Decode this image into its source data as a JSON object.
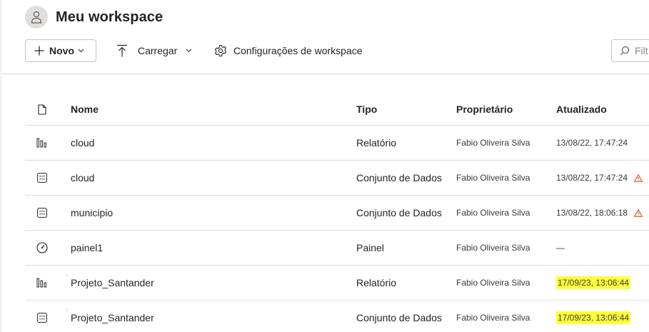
{
  "workspace": {
    "title": "Meu workspace",
    "avatar_icon": "person-icon"
  },
  "toolbar": {
    "new_label": "Novo",
    "upload_label": "Carregar",
    "settings_label": "Configurações de workspace",
    "filter_placeholder": "Filt"
  },
  "table": {
    "columns": {
      "name": "Nome",
      "type": "Tipo",
      "owner": "Proprietário",
      "updated": "Atualizado"
    },
    "rows": [
      {
        "icon": "report-icon",
        "name": "cloud",
        "type": "Relatório",
        "owner": "Fabio Oliveira Silva",
        "updated": "13/08/22, 17:47:24",
        "warning": false,
        "highlighted": false
      },
      {
        "icon": "dataset-icon",
        "name": "cloud",
        "type": "Conjunto de Dados",
        "owner": "Fabio Oliveira Silva",
        "updated": "13/08/22, 17:47:24",
        "warning": true,
        "highlighted": false
      },
      {
        "icon": "dataset-icon",
        "name": "municipio",
        "type": "Conjunto de Dados",
        "owner": "Fabio Oliveira Silva",
        "updated": "13/08/22, 18:06:18",
        "warning": true,
        "highlighted": false
      },
      {
        "icon": "dashboard-icon",
        "name": "painel1",
        "type": "Painel",
        "owner": "Fabio Oliveira Silva",
        "updated": "—",
        "warning": false,
        "highlighted": false
      },
      {
        "icon": "report-icon",
        "name": "Projeto_Santander",
        "type": "Relatório",
        "owner": "Fabio Oliveira Silva",
        "updated": "17/09/23, 13:06:44",
        "warning": false,
        "highlighted": true
      },
      {
        "icon": "dataset-icon",
        "name": "Projeto_Santander",
        "type": "Conjunto de Dados",
        "owner": "Fabio Oliveira Silva",
        "updated": "17/09/23, 13:06:44",
        "warning": false,
        "highlighted": true
      }
    ]
  },
  "colors": {
    "warning": "#d83b01",
    "highlight": "#ffff3b"
  }
}
